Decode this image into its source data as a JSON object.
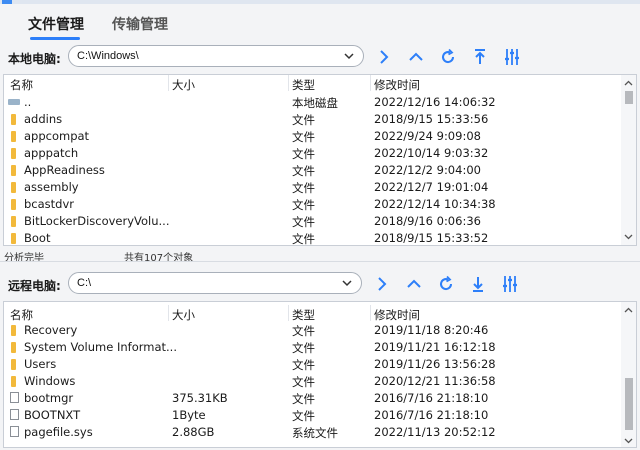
{
  "tabs": [
    {
      "label": "文件管理"
    },
    {
      "label": "传输管理"
    }
  ],
  "local": {
    "label": "本地电脑:",
    "path": "C:\\Windows\\",
    "columns": [
      "名称",
      "大小",
      "类型",
      "修改时间"
    ],
    "rows": [
      {
        "name": "..",
        "size": "",
        "type": "本地磁盘",
        "modified": "2022/12/16 14:06:32",
        "icon": "drive-icon"
      },
      {
        "name": "addins",
        "size": "",
        "type": "文件",
        "modified": "2018/9/15 15:33:56",
        "icon": "folder-icon"
      },
      {
        "name": "appcompat",
        "size": "",
        "type": "文件",
        "modified": "2022/9/24 9:09:08",
        "icon": "folder-icon"
      },
      {
        "name": "apppatch",
        "size": "",
        "type": "文件",
        "modified": "2022/10/14 9:03:32",
        "icon": "folder-icon"
      },
      {
        "name": "AppReadiness",
        "size": "",
        "type": "文件",
        "modified": "2022/12/2 9:04:00",
        "icon": "folder-icon"
      },
      {
        "name": "assembly",
        "size": "",
        "type": "文件",
        "modified": "2022/12/7 19:01:04",
        "icon": "folder-icon"
      },
      {
        "name": "bcastdvr",
        "size": "",
        "type": "文件",
        "modified": "2022/12/14 10:34:38",
        "icon": "folder-icon"
      },
      {
        "name": "BitLockerDiscoveryVolu...",
        "size": "",
        "type": "文件",
        "modified": "2018/9/16 0:06:36",
        "icon": "folder-icon"
      },
      {
        "name": "Boot",
        "size": "",
        "type": "文件",
        "modified": "2018/9/15 15:33:52",
        "icon": "folder-icon"
      }
    ],
    "status_left": "分析完毕",
    "status_right": "共有107个对象"
  },
  "remote": {
    "label": "远程电脑:",
    "path": "C:\\",
    "columns": [
      "名称",
      "大小",
      "类型",
      "修改时间"
    ],
    "rows": [
      {
        "name": "Recovery",
        "size": "",
        "type": "文件",
        "modified": "2019/11/18 8:20:46",
        "icon": "folder-icon"
      },
      {
        "name": "System Volume Informat...",
        "size": "",
        "type": "文件",
        "modified": "2019/11/21 16:12:18",
        "icon": "folder-icon"
      },
      {
        "name": "Users",
        "size": "",
        "type": "文件",
        "modified": "2019/11/26 13:56:28",
        "icon": "folder-icon"
      },
      {
        "name": "Windows",
        "size": "",
        "type": "文件",
        "modified": "2020/12/21 11:36:58",
        "icon": "folder-icon"
      },
      {
        "name": "bootmgr",
        "size": "375.31KB",
        "type": "文件",
        "modified": "2016/7/16 21:18:10",
        "icon": "file-icon"
      },
      {
        "name": "BOOTNXT",
        "size": "1Byte",
        "type": "文件",
        "modified": "2016/7/16 21:18:10",
        "icon": "file-icon"
      },
      {
        "name": "pagefile.sys",
        "size": "2.88GB",
        "type": "系统文件",
        "modified": "2022/11/13 20:52:12",
        "icon": "file-icon"
      }
    ]
  },
  "colors": {
    "accent": "#2d7ff9",
    "folder": "#f2b93b"
  }
}
